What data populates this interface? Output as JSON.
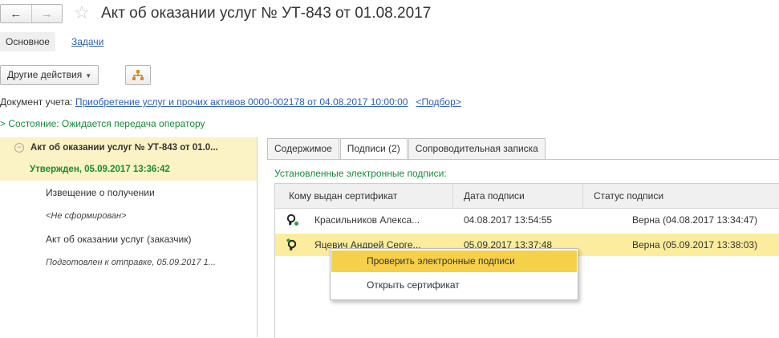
{
  "window": {
    "back_icon": "arrow-left-icon",
    "forward_icon": "arrow-right-icon",
    "favorite_icon": "star-icon",
    "title": "Акт об оказании услуг № УТ-843 от 01.08.2017"
  },
  "tabs": {
    "main": "Основное",
    "tasks": "Задачи"
  },
  "toolbar": {
    "other_actions": "Другие действия",
    "structure_icon": "document-structure-icon"
  },
  "doc_info": {
    "label": "Документ учета:",
    "link": "Приобретение услуг и прочих активов 0000-002178 от 04.08.2017 10:00:00",
    "pick": "<Подбор>"
  },
  "state": {
    "text": "Состояние: Ожидается передача оператору"
  },
  "tree": {
    "root": "Акт об оказании услуг № УТ-843 от 01.0...",
    "approved": "Утвержден, 05.09.2017 13:36:42",
    "item1": "Извещение о получении",
    "item1_status": "<Не сформирован>",
    "item2": "Акт об оказании услуг (заказчик)",
    "item2_status": "Подготовлен к отправке, 05.09.2017 1..."
  },
  "right_tabs": [
    "Содержимое",
    "Подписи (2)",
    "Сопроводительная записка"
  ],
  "signatures": {
    "caption": "Установленные электронные подписи:",
    "columns": [
      "Кому выдан сертификат",
      "Дата подписи",
      "Статус подписи"
    ],
    "rows": [
      {
        "icon": "certificate-icon",
        "name": "Красильников Алекса...",
        "date": "04.08.2017 13:54:55",
        "status": "Верна (04.08.2017 13:34:47)"
      },
      {
        "icon": "certificate-icon",
        "name": "Яцевич Андрей Серге...",
        "date": "05.09.2017 13:37:48",
        "status": "Верна (05.09.2017 13:38:03)"
      }
    ]
  },
  "context_menu": {
    "items": [
      "Проверить электронные подписи",
      "Открыть сертификат"
    ]
  },
  "colors": {
    "link": "#2b5fb4",
    "green": "#1a8a3a",
    "highlight": "#fbf3c5",
    "selected_row": "#fbed9d",
    "menu_hover": "#f7d04a"
  }
}
